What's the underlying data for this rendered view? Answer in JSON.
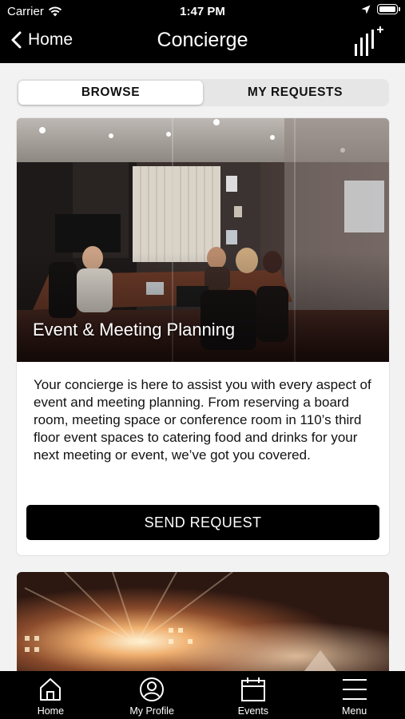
{
  "status_bar": {
    "carrier": "Carrier",
    "time": "1:47 PM"
  },
  "nav": {
    "back_label": "Home",
    "title": "Concierge"
  },
  "segments": {
    "browse": "BROWSE",
    "my_requests": "MY REQUESTS",
    "selected": "BROWSE"
  },
  "card": {
    "title": "Event & Meeting Planning",
    "description": "Your concierge is here to assist you with every aspect of event and meeting planning. From reserving a board room, meeting space or conference room in 110’s third floor event spaces to catering food and drinks for your next meeting or event, we’ve got you covered.",
    "button_label": "SEND REQUEST"
  },
  "tab_bar": {
    "items": [
      {
        "label": "Home",
        "icon": "home-icon"
      },
      {
        "label": "My Profile",
        "icon": "profile-icon"
      },
      {
        "label": "Events",
        "icon": "calendar-icon"
      },
      {
        "label": "Menu",
        "icon": "menu-icon"
      }
    ]
  },
  "colors": {
    "header_bg": "#000000",
    "page_bg": "#f2f2f2",
    "button_bg": "#000000",
    "button_text": "#ffffff"
  }
}
